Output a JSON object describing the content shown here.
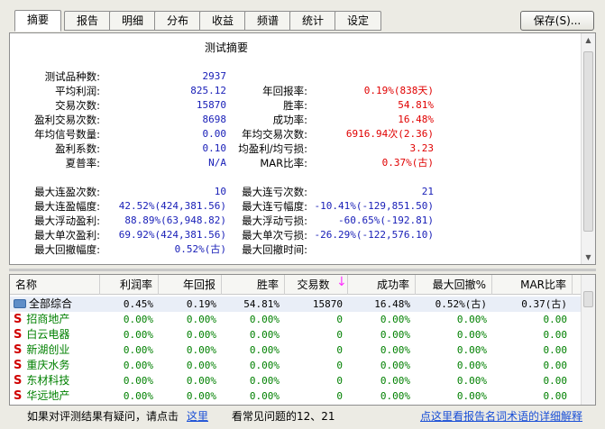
{
  "tabs": [
    "摘要",
    "报告",
    "明细",
    "分布",
    "收益",
    "频谱",
    "统计",
    "设定"
  ],
  "save_label": "保存(S)...",
  "summary": {
    "title": "测试摘要",
    "left": [
      {
        "label": "测试品种数:",
        "value": "2937"
      },
      {
        "label": "平均利润:",
        "value": "825.12"
      },
      {
        "label": "交易次数:",
        "value": "15870"
      },
      {
        "label": "盈利交易次数:",
        "value": "8698"
      },
      {
        "label": "年均信号数量:",
        "value": "0.00"
      },
      {
        "label": "盈利系数:",
        "value": "0.10"
      },
      {
        "label": "夏普率:",
        "value": "N/A"
      }
    ],
    "right": [
      {
        "label": "年回报率:",
        "value": "0.19%(838天)"
      },
      {
        "label": "胜率:",
        "value": "54.81%"
      },
      {
        "label": "成功率:",
        "value": "16.48%"
      },
      {
        "label": "年均交易次数:",
        "value": "6916.94次(2.36)"
      },
      {
        "label": "均盈利/均亏损:",
        "value": "3.23"
      },
      {
        "label": "MAR比率:",
        "value": "0.37%(古)"
      }
    ],
    "left2": [
      {
        "label": "最大连盈次数:",
        "value": "10"
      },
      {
        "label": "最大连盈幅度:",
        "value": "42.52%(424,381.56)"
      },
      {
        "label": "最大浮动盈利:",
        "value": "88.89%(63,948.82)"
      },
      {
        "label": "最大单次盈利:",
        "value": "69.92%(424,381.56)"
      },
      {
        "label": "最大回撤幅度:",
        "value": "0.52%(古)"
      }
    ],
    "right2": [
      {
        "label": "最大连亏次数:",
        "value": "21"
      },
      {
        "label": "最大连亏幅度:",
        "value": "-10.41%(-129,851.50)"
      },
      {
        "label": "最大浮动亏损:",
        "value": "-60.65%(-192.81)"
      },
      {
        "label": "最大单次亏损:",
        "value": "-26.29%(-122,576.10)"
      },
      {
        "label": "最大回撤时间:",
        "value": ""
      }
    ]
  },
  "grid": {
    "columns": [
      "名称",
      "利润率",
      "年回报",
      "胜率",
      "交易数",
      "成功率",
      "最大回撤%",
      "MAR比率"
    ],
    "rows": [
      {
        "name": "全部综合",
        "values": [
          "0.45%",
          "0.19%",
          "54.81%",
          "15870",
          "16.48%",
          "0.52%(古)",
          "0.37(古)"
        ],
        "kind": "all"
      },
      {
        "name": "招商地产",
        "values": [
          "0.00%",
          "0.00%",
          "0.00%",
          "0",
          "0.00%",
          "0.00%",
          "0.00"
        ],
        "kind": "stock"
      },
      {
        "name": "白云电器",
        "values": [
          "0.00%",
          "0.00%",
          "0.00%",
          "0",
          "0.00%",
          "0.00%",
          "0.00"
        ],
        "kind": "stock"
      },
      {
        "name": "新湖创业",
        "values": [
          "0.00%",
          "0.00%",
          "0.00%",
          "0",
          "0.00%",
          "0.00%",
          "0.00"
        ],
        "kind": "stock"
      },
      {
        "name": "重庆水务",
        "values": [
          "0.00%",
          "0.00%",
          "0.00%",
          "0",
          "0.00%",
          "0.00%",
          "0.00"
        ],
        "kind": "stock"
      },
      {
        "name": "东材科技",
        "values": [
          "0.00%",
          "0.00%",
          "0.00%",
          "0",
          "0.00%",
          "0.00%",
          "0.00"
        ],
        "kind": "stock"
      },
      {
        "name": "华远地产",
        "values": [
          "0.00%",
          "0.00%",
          "0.00%",
          "0",
          "0.00%",
          "0.00%",
          "0.00"
        ],
        "kind": "stock"
      }
    ]
  },
  "footer": {
    "question_text": "如果对评测结果有疑问，请点击",
    "here_link": "这里",
    "faq_text": "看常见问题的12、21",
    "glossary_link": "点这里看报告名词术语的详细解释"
  }
}
